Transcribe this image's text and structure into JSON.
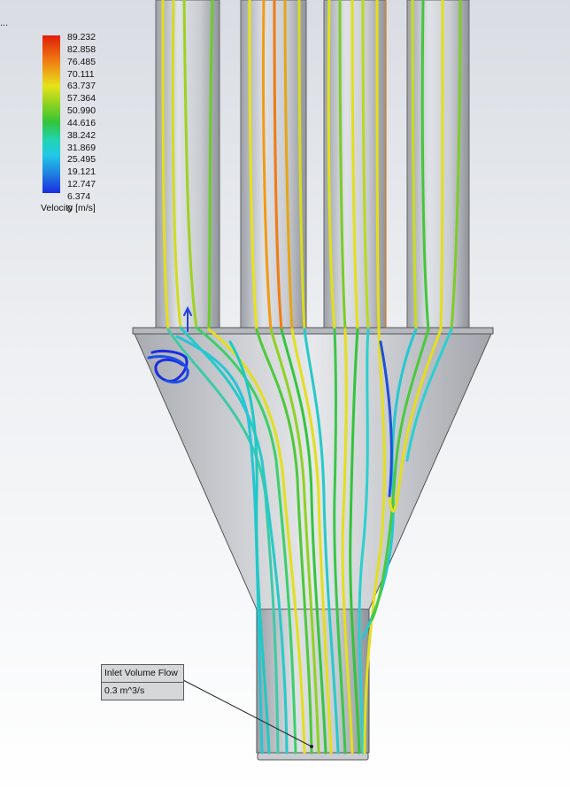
{
  "corner_text": "...",
  "legend": {
    "title": "Velocity [m/s]",
    "ticks": [
      "89.232",
      "82.858",
      "76.485",
      "70.111",
      "63.737",
      "57.364",
      "50.990",
      "44.616",
      "38.242",
      "31.869",
      "25.495",
      "19.121",
      "12.747",
      "6.374",
      "0"
    ]
  },
  "callout": {
    "label": "Inlet Volume Flow",
    "value": "0.3 m^3/s"
  },
  "colors": {
    "low": "#1a2de0",
    "cyan": "#22d4d8",
    "green": "#33c43a",
    "yellow": "#e7e31a",
    "orange": "#f07b12",
    "high": "#e11c0a",
    "geometry_gray": "#b9bcc2"
  }
}
